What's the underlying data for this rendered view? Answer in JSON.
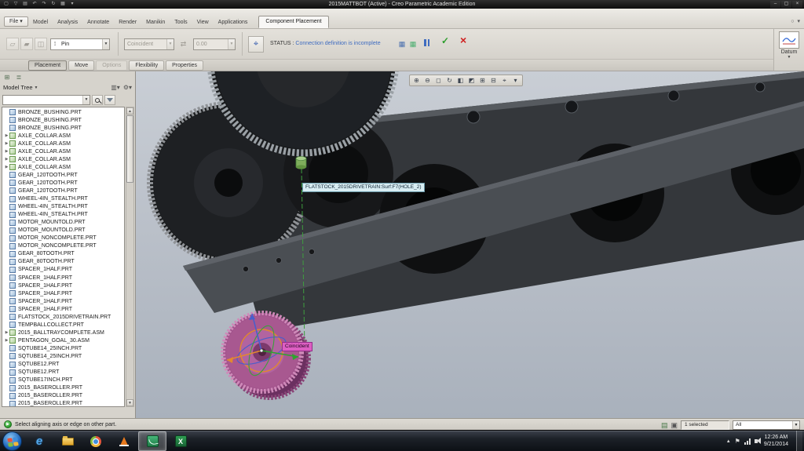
{
  "colors": {
    "status_message_blue": "#3f6cc0",
    "constraint_tag_magenta": "#dd5ec2",
    "accept_green": "#2d9e2d",
    "cancel_red": "#cf2020",
    "viewport_top": "#c9ced5",
    "viewport_bottom": "#a9b1bc",
    "model_dark_gray": "#34373b",
    "component_purple": "#a2538c"
  },
  "titlebar": {
    "title": "2015MATTBOT (Active) - Creo Parametric Academic Edition",
    "quick_access": [
      {
        "name": "new-window-icon",
        "glyph": "▢"
      },
      {
        "name": "open-icon",
        "glyph": "▽"
      },
      {
        "name": "save-icon",
        "glyph": "▤"
      },
      {
        "name": "undo-icon",
        "glyph": "↶"
      },
      {
        "name": "redo-icon",
        "glyph": "↷"
      },
      {
        "name": "regenerate-icon",
        "glyph": "↻"
      },
      {
        "name": "window-icon",
        "glyph": "▦"
      },
      {
        "name": "customize-toolbar-icon",
        "glyph": "▾"
      }
    ],
    "window_controls": [
      {
        "name": "minimize-button",
        "glyph": "–"
      },
      {
        "name": "maximize-button",
        "glyph": "▢"
      },
      {
        "name": "close-button",
        "glyph": "×"
      }
    ]
  },
  "ribbon": {
    "file_label": "File ▾",
    "tabs": [
      "Model",
      "Analysis",
      "Annotate",
      "Render",
      "Manikin",
      "Tools",
      "View",
      "Applications"
    ],
    "context_tab": "Component Placement",
    "mini_icons": [
      {
        "name": "command-search-icon",
        "glyph": "○"
      },
      {
        "name": "minimize-ribbon-icon",
        "glyph": "▾"
      }
    ],
    "left_icons": [
      {
        "name": "user-defined-set-icon",
        "glyph": "▱"
      },
      {
        "name": "predefined-set-icon",
        "glyph": "▰"
      },
      {
        "name": "convert-constraint-icon",
        "glyph": "◫"
      }
    ],
    "connection_combo": {
      "value": "Pin"
    },
    "constraint_combo": {
      "value": "Coincident"
    },
    "flip_icon_glyph": "⇄",
    "offset_field": {
      "value": "0.00"
    },
    "dragger_icon_glyph": "⌖",
    "status_label": "STATUS :",
    "status_message": "Connection definition is incomplete",
    "mini_status_icons": [
      {
        "name": "placement-table-icon",
        "glyph": "▦",
        "color": "#4a6fae"
      },
      {
        "name": "connection-table-icon",
        "glyph": "▦",
        "color": "#4aae6f"
      }
    ],
    "accept_glyph": "✓",
    "cancel_glyph": "×",
    "datum_label": "Datum",
    "sub_tabs": [
      {
        "label": "Placement",
        "state": "active"
      },
      {
        "label": "Move"
      },
      {
        "label": "Options",
        "state": "disabled"
      },
      {
        "label": "Flexibility"
      },
      {
        "label": "Properties"
      }
    ]
  },
  "model_tree": {
    "title": "Model Tree",
    "toolbar_icons": [
      {
        "name": "show-model-tree-icon",
        "glyph": "⊞"
      },
      {
        "name": "layer-tree-icon",
        "glyph": "≣"
      }
    ],
    "header_icons": [
      {
        "name": "tree-columns-icon",
        "glyph": "▥▾"
      },
      {
        "name": "tree-settings-icon",
        "glyph": "⚙▾"
      }
    ],
    "items": [
      {
        "label": "BRONZE_BUSHING.PRT",
        "type": "prt"
      },
      {
        "label": "BRONZE_BUSHING.PRT",
        "type": "prt"
      },
      {
        "label": "BRONZE_BUSHING.PRT",
        "type": "prt"
      },
      {
        "label": "AXLE_COLLAR.ASM",
        "type": "asm",
        "exp": true
      },
      {
        "label": "AXLE_COLLAR.ASM",
        "type": "asm",
        "exp": true
      },
      {
        "label": "AXLE_COLLAR.ASM",
        "type": "asm",
        "exp": true
      },
      {
        "label": "AXLE_COLLAR.ASM",
        "type": "asm",
        "exp": true
      },
      {
        "label": "AXLE_COLLAR.ASM",
        "type": "asm",
        "exp": true
      },
      {
        "label": "GEAR_120TOOTH.PRT",
        "type": "prt"
      },
      {
        "label": "GEAR_120TOOTH.PRT",
        "type": "prt"
      },
      {
        "label": "GEAR_120TOOTH.PRT",
        "type": "prt"
      },
      {
        "label": "WHEEL-4IN_STEALTH.PRT",
        "type": "prt"
      },
      {
        "label": "WHEEL-4IN_STEALTH.PRT",
        "type": "prt"
      },
      {
        "label": "WHEEL-4IN_STEALTH.PRT",
        "type": "prt"
      },
      {
        "label": "MOTOR_MOUNTOLD.PRT",
        "type": "prt"
      },
      {
        "label": "MOTOR_MOUNTOLD.PRT",
        "type": "prt"
      },
      {
        "label": "MOTOR_NONCOMPLETE.PRT",
        "type": "prt"
      },
      {
        "label": "MOTOR_NONCOMPLETE.PRT",
        "type": "prt"
      },
      {
        "label": "GEAR_80TOOTH.PRT",
        "type": "prt"
      },
      {
        "label": "GEAR_80TOOTH.PRT",
        "type": "prt"
      },
      {
        "label": "SPACER_1HALF.PRT",
        "type": "prt"
      },
      {
        "label": "SPACER_1HALF.PRT",
        "type": "prt"
      },
      {
        "label": "SPACER_1HALF.PRT",
        "type": "prt"
      },
      {
        "label": "SPACER_1HALF.PRT",
        "type": "prt"
      },
      {
        "label": "SPACER_1HALF.PRT",
        "type": "prt"
      },
      {
        "label": "SPACER_1HALF.PRT",
        "type": "prt"
      },
      {
        "label": "FLATSTOCK_2015DRIVETRAIN.PRT",
        "type": "prt"
      },
      {
        "label": "TEMPBALLCOLLECT.PRT",
        "type": "prt"
      },
      {
        "label": "2015_BALLTRAYCOMPLETE.ASM",
        "type": "asm",
        "exp": true
      },
      {
        "label": "PENTAGON_GOAL_30.ASM",
        "type": "asm",
        "exp": true
      },
      {
        "label": "SQTUBE14_25INCH.PRT",
        "type": "prt"
      },
      {
        "label": "SQTUBE14_25INCH.PRT",
        "type": "prt"
      },
      {
        "label": "SQTUBE12.PRT",
        "type": "prt"
      },
      {
        "label": "SQTUBE12.PRT",
        "type": "prt"
      },
      {
        "label": "SQTUBE17INCH.PRT",
        "type": "prt"
      },
      {
        "label": "2015_BASEROLLER.PRT",
        "type": "prt"
      },
      {
        "label": "2015_BASEROLLER.PRT",
        "type": "prt"
      },
      {
        "label": "2015_BASEROLLER.PRT",
        "type": "prt"
      }
    ]
  },
  "viewport": {
    "toolbar": [
      {
        "name": "zoom-in-icon",
        "glyph": "⊕"
      },
      {
        "name": "zoom-out-icon",
        "glyph": "⊖"
      },
      {
        "name": "refit-icon",
        "glyph": "◻"
      },
      {
        "name": "repaint-icon",
        "glyph": "↻"
      },
      {
        "name": "display-style-icon",
        "glyph": "◧"
      },
      {
        "name": "perspective-icon",
        "glyph": "◩"
      },
      {
        "name": "datum-display-icon",
        "glyph": "⊞"
      },
      {
        "name": "annotation-display-icon",
        "glyph": "⊟"
      },
      {
        "name": "spin-center-icon",
        "glyph": "⌖"
      },
      {
        "name": "saved-orientations-icon",
        "glyph": "▾"
      }
    ],
    "tooltip": "FLATSTOCK_2015DRIVETRAIN:Surf:F7(HOLE_2)",
    "constraint_tag": "Coincident"
  },
  "status_bar": {
    "prompt": "Select aligning axis or edge on other part.",
    "tool_icons": [
      {
        "name": "find-tool-icon",
        "glyph": "▤"
      },
      {
        "name": "select-set-icon",
        "glyph": "▣"
      }
    ],
    "selected_count": "1 selected",
    "filter_value": "All"
  },
  "taskbar": {
    "ie_glyph": "e",
    "excel_glyph": "X",
    "clock_time": "12:26 AM",
    "clock_date": "9/21/2014"
  }
}
